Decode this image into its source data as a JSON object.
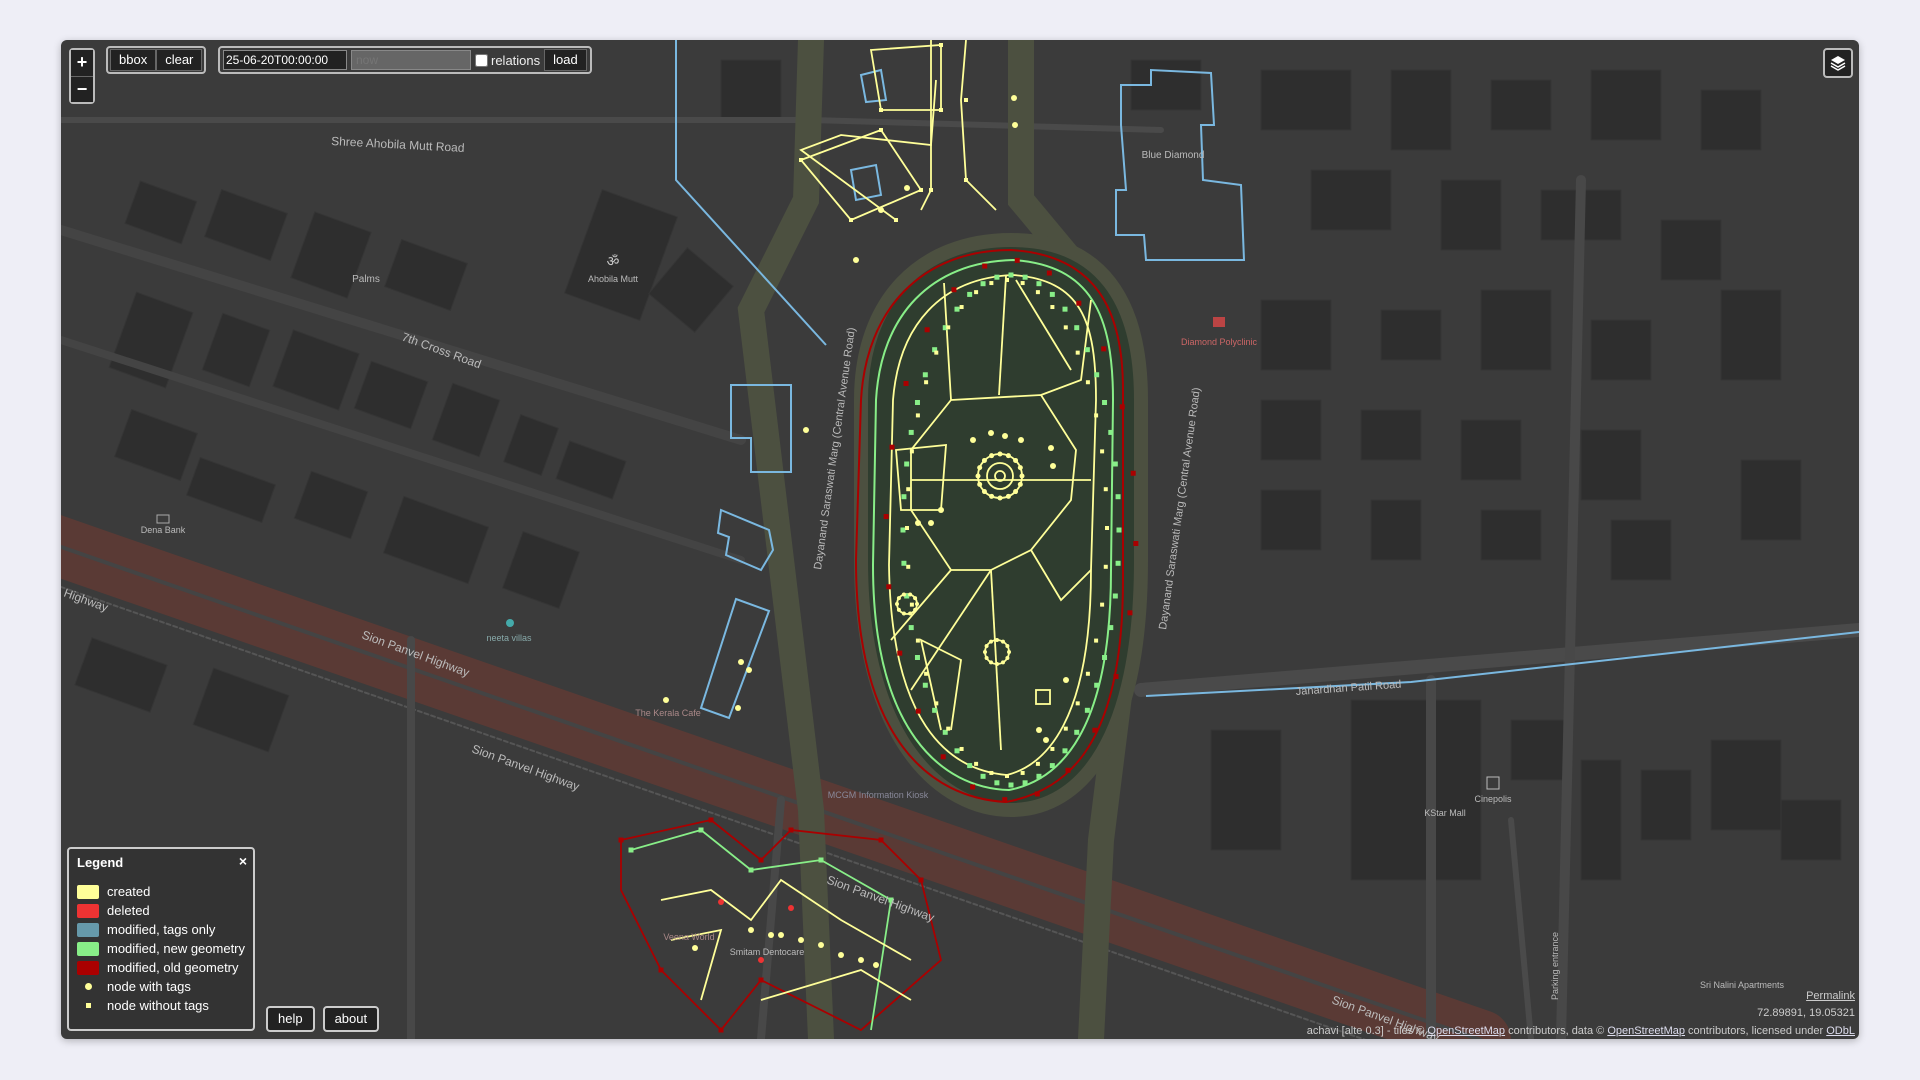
{
  "toolbar": {
    "zoom_in": "+",
    "zoom_out": "−",
    "bbox_label": "bbox",
    "clear_label": "clear",
    "date_from": "25-06-20T00:00:00",
    "date_to_placeholder": "now",
    "relations_label": "relations",
    "load_label": "load",
    "layers_icon": "layers-icon"
  },
  "legend": {
    "title": "Legend",
    "close": "×",
    "items": [
      {
        "label": "created",
        "color": "#ffff99"
      },
      {
        "label": "deleted",
        "color": "#ee3333"
      },
      {
        "label": "modified, tags only",
        "color": "#6699aa"
      },
      {
        "label": "modified, new geometry",
        "color": "#88ee88"
      },
      {
        "label": "modified, old geometry",
        "color": "#aa0000"
      }
    ],
    "node_tags": "node with tags",
    "node_notags": "node without tags"
  },
  "buttons": {
    "help": "help",
    "about": "about"
  },
  "footer": {
    "permalink": "Permalink",
    "coords": "72.89891, 19.05321",
    "attrib_prefix": "achavi [alte 0.3] - tiles ©",
    "attrib_osm1": "OpenStreetMap",
    "attrib_mid": "contributors, data ©",
    "attrib_osm2": "OpenStreetMap",
    "attrib_suffix": "contributors, licensed under",
    "attrib_odbl": "ODbL"
  },
  "map_labels": {
    "road_shree": "Shree Ahobila Mutt Road",
    "road_7th": "7th Cross Road",
    "road_dayanand_left": "Dayanand Saraswati Marg (Central Avenue Road)",
    "road_dayanand_right": "Dayanand Saraswati Marg (Central Avenue Road)",
    "road_sion1": "Sion Panvel Highway",
    "road_sion2": "Sion Panvel Highway",
    "road_sion3": "Sion Panvel Highway",
    "road_sion4": "Sion Panvel Highway",
    "road_highway": "Highway",
    "road_janardhan": "Janardhan Patil Road",
    "poi_palms": "Palms",
    "poi_ahobila": "Ahobila Mutt",
    "poi_dena": "Dena Bank",
    "poi_neeta": "neeta villas",
    "poi_blue": "Blue Diamond",
    "poi_diamond": "Diamond Polyclinic",
    "poi_kstar": "KStar Mall",
    "poi_cinepolis": "Cinepolis",
    "poi_mcgm": "MCGM Information Kiosk",
    "poi_kerala": "The Kerala Cafe",
    "poi_parking": "Parking entrance",
    "poi_srinalini": "Sri Nalini Apartments",
    "poi_smitam": "Smitam Dentocare",
    "poi_veena": "Veena World"
  },
  "colors": {
    "created": "#ffff99",
    "deleted": "#ee3333",
    "tags_only": "#6699aa",
    "new_geom": "#88ee88",
    "old_geom": "#aa0000",
    "blue_outline": "#7ab8e0",
    "background": "#3b3b3b"
  }
}
